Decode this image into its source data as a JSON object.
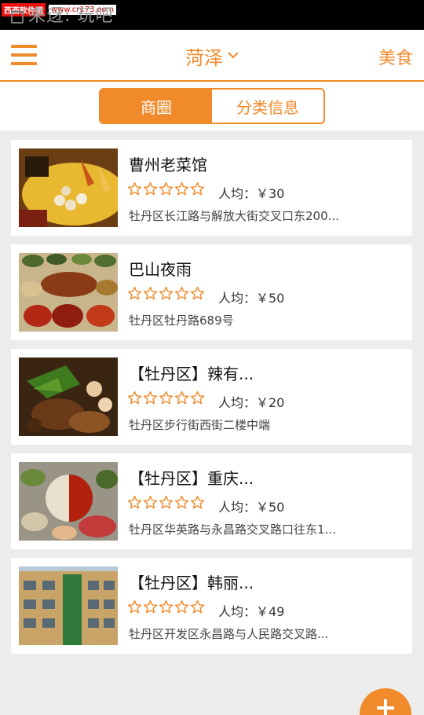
{
  "watermark": {
    "site_name": "西西软件园",
    "site_url": "www.cr173.com"
  },
  "status_bar": {
    "text": "来迓: 玩吧"
  },
  "header": {
    "city": "菏泽",
    "category": "美食"
  },
  "segment": {
    "tabs": [
      {
        "label": "商圈"
      },
      {
        "label": "分类信息"
      }
    ],
    "active_index": 0
  },
  "listings": [
    {
      "name": "曹州老菜馆",
      "rating": 0,
      "max_rating": 5,
      "price_label": "人均：￥30",
      "address": "牡丹区长江路与解放大街交叉口东200..."
    },
    {
      "name": "巴山夜雨",
      "rating": 0,
      "max_rating": 5,
      "price_label": "人均：￥50",
      "address": "牡丹区牡丹路689号"
    },
    {
      "name": "【牡丹区】辣有...",
      "rating": 0,
      "max_rating": 5,
      "price_label": "人均：￥20",
      "address": "牡丹区步行街西街二楼中端"
    },
    {
      "name": "【牡丹区】重庆...",
      "rating": 0,
      "max_rating": 5,
      "price_label": "人均：￥50",
      "address": "牡丹区华英路与永昌路交叉路口往东1..."
    },
    {
      "name": "【牡丹区】韩丽...",
      "rating": 0,
      "max_rating": 5,
      "price_label": "人均：￥49",
      "address": "牡丹区开发区永昌路与人民路交叉路..."
    }
  ],
  "colors": {
    "accent": "#f08a2a",
    "background": "#ececec"
  },
  "icons": {
    "menu": "hamburger-icon",
    "dropdown": "chevron-down-icon",
    "rating": "star-outline-icon",
    "fab": "plus-icon"
  }
}
